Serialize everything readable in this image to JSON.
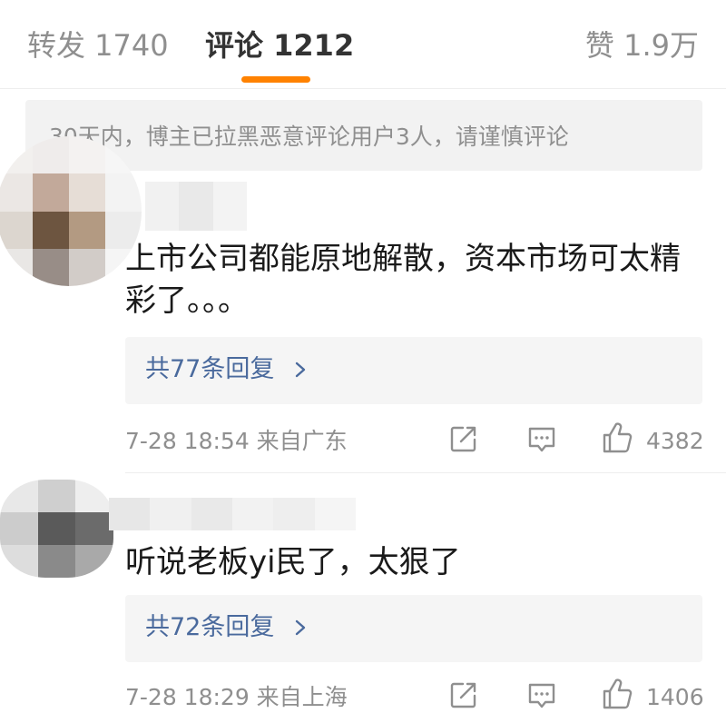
{
  "tabs": {
    "repost": "转发 1740",
    "comments": "评论 1212",
    "likes": "赞 1.9万"
  },
  "accent_color": "#ff8200",
  "link_color": "#4a6a9d",
  "notice": "30天内，博主已拉黑恶意评论用户3人，请谨慎评论",
  "comments": [
    {
      "text": "上市公司都能原地解散，资本市场可太精彩了。。。",
      "replies_label": "共77条回复",
      "timestamp": "7-28 18:54 来自广东",
      "like_count": "4382",
      "avatar": "blurred-avatar",
      "username": "blurred"
    },
    {
      "text": "听说老板yi民了，太狠了",
      "replies_label": "共72条回复",
      "timestamp": "7-28 18:29 来自上海",
      "like_count": "1406",
      "avatar": "blurred-avatar",
      "username": "blurred"
    }
  ],
  "icons": {
    "share": "share-icon",
    "comment": "comment-icon",
    "like": "thumbs-up-icon",
    "chevron": "chevron-right-icon"
  }
}
